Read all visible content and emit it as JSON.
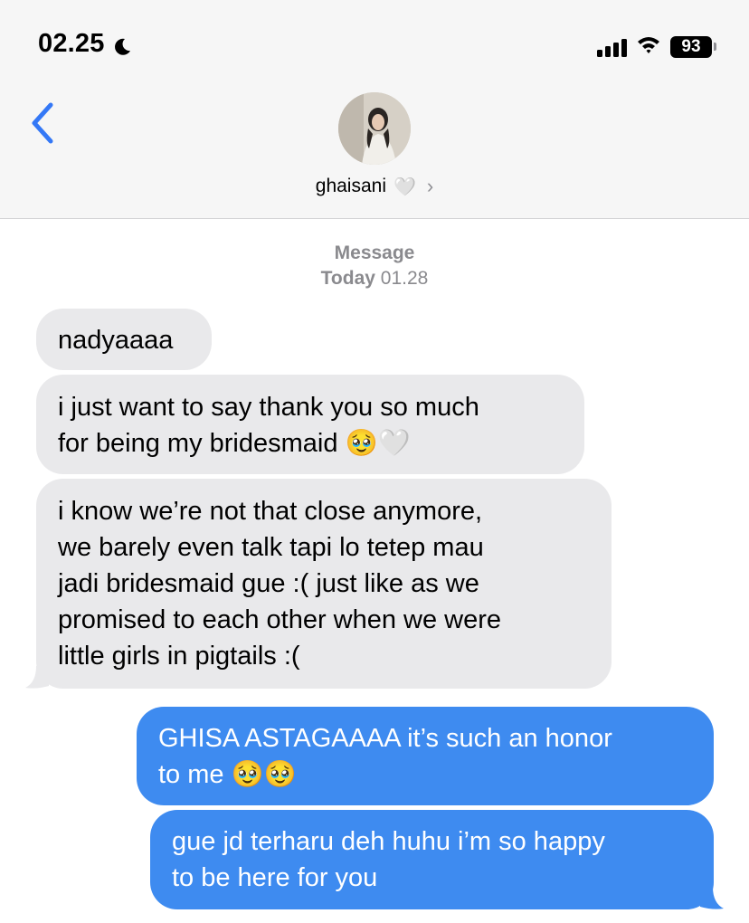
{
  "status_bar": {
    "time": "02.25",
    "battery": "93"
  },
  "header": {
    "contact_name": "ghaisani",
    "name_emoji": "🤍",
    "chevron": "›"
  },
  "thread": {
    "service_label": "Message",
    "day_label": "Today",
    "time_label": "01.28"
  },
  "messages": [
    {
      "direction": "incoming",
      "text": "nadyaaaa"
    },
    {
      "direction": "incoming",
      "text": "i just want to say thank you so much\nfor being my bridesmaid 🥹🤍"
    },
    {
      "direction": "incoming",
      "text": "i know we’re not that close anymore,\nwe barely even talk tapi lo tetep mau\njadi bridesmaid gue :( just like as we\npromised to each other when we were\nlittle girls in pigtails :("
    },
    {
      "direction": "outgoing",
      "text": "GHISA ASTAGAAAA it’s such an honor\nto me 🥹🥹"
    },
    {
      "direction": "outgoing",
      "text": "gue jd terharu deh huhu i’m so happy\nto be here for you"
    }
  ],
  "colors": {
    "incoming_bubble": "#e9e9eb",
    "outgoing_bubble": "#3e8bf0",
    "accent": "#3478f6"
  },
  "icons": [
    "moon-icon",
    "cellular-signal-icon",
    "wifi-icon",
    "battery-icon",
    "back-chevron-icon",
    "chevron-right-icon"
  ]
}
